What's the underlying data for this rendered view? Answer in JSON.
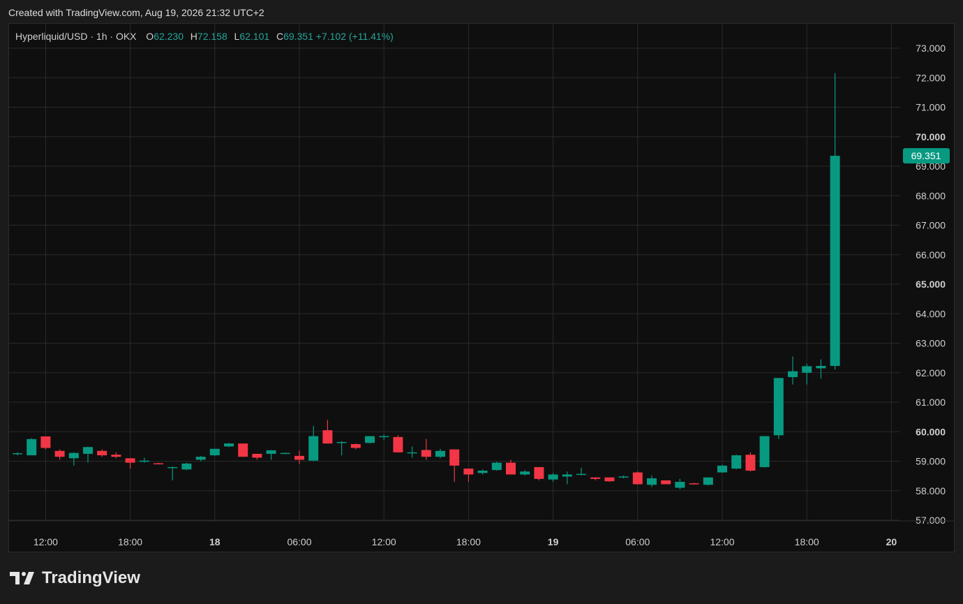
{
  "caption": "Created with TradingView.com, Aug 19, 2026 21:32 UTC+2",
  "legend": {
    "symbol": "Hyperliquid/USD · 1h · OKX",
    "o_label": "O",
    "o_value": "62.230",
    "h_label": "H",
    "h_value": "72.158",
    "l_label": "L",
    "l_value": "62.101",
    "c_label": "C",
    "c_value": "69.351",
    "change": "+7.102 (+11.41%)"
  },
  "brand": {
    "name": "TradingView",
    "icon": "tradingview-logo-icon"
  },
  "colors": {
    "up": "#089981",
    "down": "#f23645",
    "background": "#0f0f0f",
    "grid": "#2a2a2a",
    "text": "#cfcfcf"
  },
  "chart_data": {
    "type": "candlestick",
    "interval": "1h",
    "ylim": [
      56.7,
      73.5
    ],
    "ticks_y": [
      57,
      58,
      59,
      60,
      61,
      62,
      63,
      64,
      65,
      66,
      67,
      68,
      69,
      70,
      71,
      72,
      73
    ],
    "tick_y_labels": [
      "57.000",
      "58.000",
      "59.000",
      "60.000",
      "61.000",
      "62.000",
      "63.000",
      "64.000",
      "65.000",
      "66.000",
      "67.000",
      "68.000",
      "69.000",
      "70.000",
      "71.000",
      "72.000",
      "73.000"
    ],
    "bold_y_ticks": [
      60,
      65,
      70
    ],
    "x_ticks": [
      {
        "label": "12:00",
        "index": 2,
        "bold": false
      },
      {
        "label": "18:00",
        "index": 8,
        "bold": false
      },
      {
        "label": "18",
        "index": 14,
        "bold": true
      },
      {
        "label": "06:00",
        "index": 20,
        "bold": false
      },
      {
        "label": "12:00",
        "index": 26,
        "bold": false
      },
      {
        "label": "18:00",
        "index": 32,
        "bold": false
      },
      {
        "label": "19",
        "index": 38,
        "bold": true
      },
      {
        "label": "06:00",
        "index": 44,
        "bold": false
      },
      {
        "label": "12:00",
        "index": 50,
        "bold": false
      },
      {
        "label": "18:00",
        "index": 56,
        "bold": false
      },
      {
        "label": "20",
        "index": 62,
        "bold": true
      }
    ],
    "last_price": 69.351,
    "last_price_label": "69.351",
    "candles": [
      {
        "o": 59.25,
        "h": 59.3,
        "l": 59.2,
        "c": 59.27
      },
      {
        "o": 59.2,
        "h": 59.78,
        "l": 59.2,
        "c": 59.75
      },
      {
        "o": 59.84,
        "h": 59.84,
        "l": 59.4,
        "c": 59.45
      },
      {
        "o": 59.35,
        "h": 59.4,
        "l": 59.05,
        "c": 59.15
      },
      {
        "o": 59.1,
        "h": 59.3,
        "l": 58.85,
        "c": 59.28
      },
      {
        "o": 59.25,
        "h": 59.5,
        "l": 58.95,
        "c": 59.48
      },
      {
        "o": 59.35,
        "h": 59.4,
        "l": 59.15,
        "c": 59.2
      },
      {
        "o": 59.22,
        "h": 59.3,
        "l": 59.1,
        "c": 59.15
      },
      {
        "o": 59.1,
        "h": 59.1,
        "l": 58.75,
        "c": 58.95
      },
      {
        "o": 58.98,
        "h": 59.12,
        "l": 58.95,
        "c": 59.02
      },
      {
        "o": 58.93,
        "h": 58.95,
        "l": 58.9,
        "c": 58.92
      },
      {
        "o": 58.78,
        "h": 58.82,
        "l": 58.35,
        "c": 58.8
      },
      {
        "o": 58.72,
        "h": 58.95,
        "l": 58.7,
        "c": 58.92
      },
      {
        "o": 59.05,
        "h": 59.18,
        "l": 59.0,
        "c": 59.15
      },
      {
        "o": 59.2,
        "h": 59.42,
        "l": 59.18,
        "c": 59.42
      },
      {
        "o": 59.5,
        "h": 59.62,
        "l": 59.48,
        "c": 59.6
      },
      {
        "o": 59.6,
        "h": 59.6,
        "l": 59.15,
        "c": 59.15
      },
      {
        "o": 59.25,
        "h": 59.25,
        "l": 59.05,
        "c": 59.12
      },
      {
        "o": 59.25,
        "h": 59.37,
        "l": 59.05,
        "c": 59.37
      },
      {
        "o": 59.28,
        "h": 59.3,
        "l": 59.25,
        "c": 59.28
      },
      {
        "o": 59.18,
        "h": 59.35,
        "l": 58.9,
        "c": 59.05
      },
      {
        "o": 59.02,
        "h": 60.2,
        "l": 59.0,
        "c": 59.85
      },
      {
        "o": 60.05,
        "h": 60.4,
        "l": 59.6,
        "c": 59.6
      },
      {
        "o": 59.65,
        "h": 59.68,
        "l": 59.2,
        "c": 59.65
      },
      {
        "o": 59.58,
        "h": 59.6,
        "l": 59.4,
        "c": 59.45
      },
      {
        "o": 59.62,
        "h": 59.85,
        "l": 59.6,
        "c": 59.85
      },
      {
        "o": 59.85,
        "h": 59.9,
        "l": 59.72,
        "c": 59.85
      },
      {
        "o": 59.82,
        "h": 59.88,
        "l": 59.3,
        "c": 59.3
      },
      {
        "o": 59.28,
        "h": 59.5,
        "l": 59.12,
        "c": 59.3
      },
      {
        "o": 59.38,
        "h": 59.75,
        "l": 59.05,
        "c": 59.15
      },
      {
        "o": 59.15,
        "h": 59.42,
        "l": 59.1,
        "c": 59.35
      },
      {
        "o": 59.4,
        "h": 59.4,
        "l": 58.3,
        "c": 58.85
      },
      {
        "o": 58.75,
        "h": 58.75,
        "l": 58.3,
        "c": 58.55
      },
      {
        "o": 58.6,
        "h": 58.72,
        "l": 58.55,
        "c": 58.68
      },
      {
        "o": 58.7,
        "h": 58.98,
        "l": 58.68,
        "c": 58.95
      },
      {
        "o": 58.95,
        "h": 59.05,
        "l": 58.55,
        "c": 58.55
      },
      {
        "o": 58.55,
        "h": 58.7,
        "l": 58.52,
        "c": 58.65
      },
      {
        "o": 58.8,
        "h": 58.8,
        "l": 58.35,
        "c": 58.4
      },
      {
        "o": 58.38,
        "h": 58.6,
        "l": 58.3,
        "c": 58.55
      },
      {
        "o": 58.48,
        "h": 58.65,
        "l": 58.22,
        "c": 58.55
      },
      {
        "o": 58.55,
        "h": 58.78,
        "l": 58.52,
        "c": 58.57
      },
      {
        "o": 58.45,
        "h": 58.45,
        "l": 58.35,
        "c": 58.4
      },
      {
        "o": 58.45,
        "h": 58.45,
        "l": 58.3,
        "c": 58.32
      },
      {
        "o": 58.45,
        "h": 58.52,
        "l": 58.42,
        "c": 58.48
      },
      {
        "o": 58.62,
        "h": 58.65,
        "l": 58.2,
        "c": 58.22
      },
      {
        "o": 58.2,
        "h": 58.52,
        "l": 58.12,
        "c": 58.42
      },
      {
        "o": 58.35,
        "h": 58.35,
        "l": 58.22,
        "c": 58.22
      },
      {
        "o": 58.1,
        "h": 58.4,
        "l": 58.05,
        "c": 58.3
      },
      {
        "o": 58.25,
        "h": 58.27,
        "l": 58.22,
        "c": 58.22
      },
      {
        "o": 58.2,
        "h": 58.45,
        "l": 58.18,
        "c": 58.45
      },
      {
        "o": 58.62,
        "h": 58.88,
        "l": 58.6,
        "c": 58.85
      },
      {
        "o": 58.75,
        "h": 59.22,
        "l": 58.72,
        "c": 59.2
      },
      {
        "o": 59.22,
        "h": 59.3,
        "l": 58.65,
        "c": 58.68
      },
      {
        "o": 58.8,
        "h": 59.85,
        "l": 58.78,
        "c": 59.85
      },
      {
        "o": 59.88,
        "h": 61.82,
        "l": 59.75,
        "c": 61.82
      },
      {
        "o": 61.85,
        "h": 62.55,
        "l": 61.6,
        "c": 62.05
      },
      {
        "o": 62.0,
        "h": 62.3,
        "l": 61.6,
        "c": 62.22
      },
      {
        "o": 62.15,
        "h": 62.45,
        "l": 61.8,
        "c": 62.23
      },
      {
        "o": 62.23,
        "h": 72.158,
        "l": 62.101,
        "c": 69.351
      }
    ]
  }
}
